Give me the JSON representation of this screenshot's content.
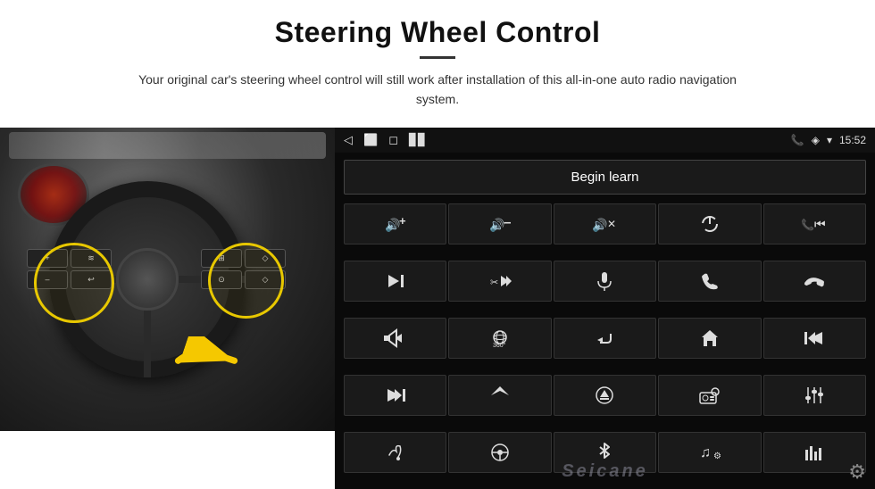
{
  "header": {
    "title": "Steering Wheel Control",
    "subtitle": "Your original car's steering wheel control will still work after installation of this all-in-one auto radio navigation system.",
    "divider": true
  },
  "headunit": {
    "statusBar": {
      "backIcon": "◁",
      "homeIcon": "⬜",
      "squareIcon": "◻",
      "signalIcons": "▊▊",
      "phone": "📞",
      "location": "◈",
      "wifi": "▾",
      "time": "15:52"
    },
    "beginLearnLabel": "Begin learn",
    "iconRows": [
      [
        "🔊+",
        "🔊–",
        "🔊×",
        "⏻",
        "📞⏮"
      ],
      [
        "⏭|",
        "✂⏭",
        "🎤",
        "📞",
        "📞↩"
      ],
      [
        "🔊◀",
        "🎯360°",
        "↩",
        "🏠",
        "|⏮⏮"
      ],
      [
        "⏭⏭|",
        "▶",
        "⊜",
        "📻",
        "⚙"
      ],
      [
        "🎤",
        "🎯",
        "✱",
        "🎵",
        "📶"
      ]
    ],
    "icons": {
      "row1": [
        "vol_up",
        "vol_down",
        "mute",
        "power",
        "phone_prev"
      ],
      "row2": [
        "next_track",
        "fast_forward_stop",
        "mic",
        "phone",
        "hangup"
      ],
      "row3": [
        "speaker_back",
        "360_view",
        "return",
        "home",
        "skip_back"
      ],
      "row4": [
        "skip_forward",
        "navigate",
        "eject",
        "radio",
        "settings_sliders"
      ],
      "row5": [
        "mic2",
        "steering",
        "bluetooth",
        "music_settings",
        "equalizer"
      ]
    },
    "watermark": "Seicane",
    "gearIcon": "⚙"
  }
}
